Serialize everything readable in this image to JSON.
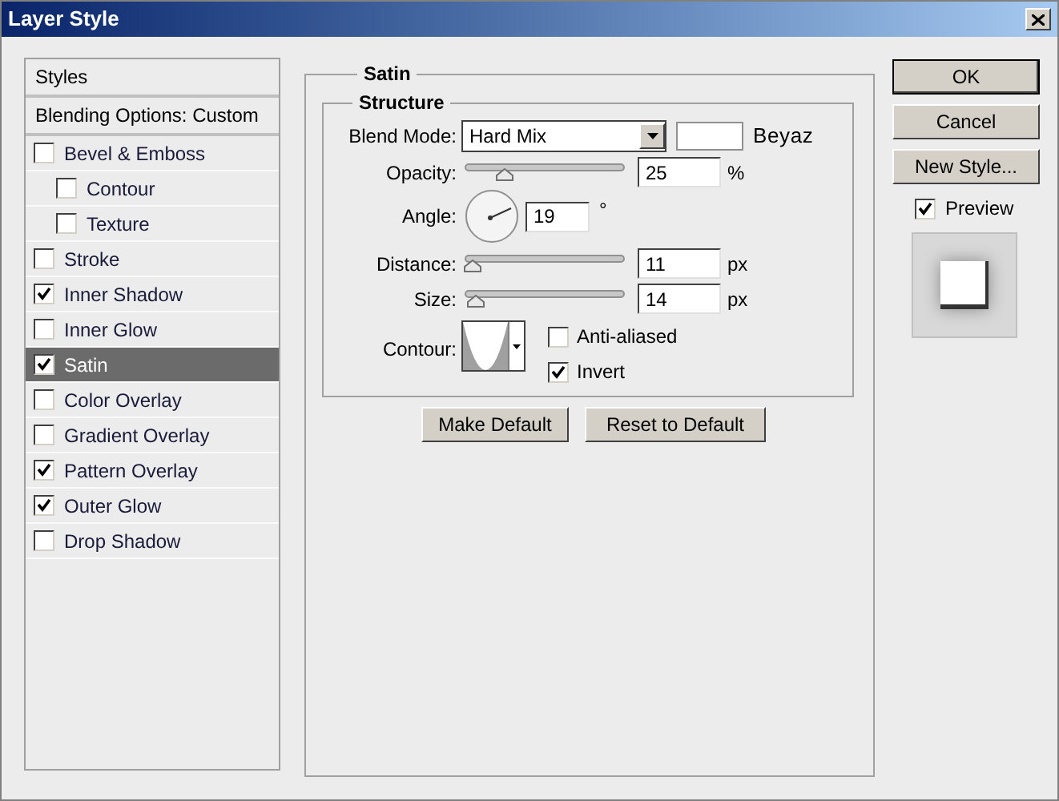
{
  "window": {
    "title": "Layer Style"
  },
  "sidebar": {
    "header": "Styles",
    "blending_options": "Blending Options: Custom",
    "items": [
      {
        "label": "Bevel & Emboss",
        "checked": false,
        "selected": false,
        "children": [
          {
            "label": "Contour",
            "checked": false,
            "selected": false
          },
          {
            "label": "Texture",
            "checked": false,
            "selected": false
          }
        ]
      },
      {
        "label": "Stroke",
        "checked": false,
        "selected": false
      },
      {
        "label": "Inner Shadow",
        "checked": true,
        "selected": false
      },
      {
        "label": "Inner Glow",
        "checked": false,
        "selected": false
      },
      {
        "label": "Satin",
        "checked": true,
        "selected": true
      },
      {
        "label": "Color Overlay",
        "checked": false,
        "selected": false
      },
      {
        "label": "Gradient Overlay",
        "checked": false,
        "selected": false
      },
      {
        "label": "Pattern Overlay",
        "checked": true,
        "selected": false
      },
      {
        "label": "Outer Glow",
        "checked": true,
        "selected": false
      },
      {
        "label": "Drop Shadow",
        "checked": false,
        "selected": false
      }
    ]
  },
  "panel": {
    "title": "Satin",
    "group": {
      "title": "Structure",
      "blend_mode": {
        "label": "Blend Mode:",
        "value": "Hard Mix",
        "color_name": "Beyaz"
      },
      "fields": [
        {
          "kind": "slider",
          "label": "Opacity:",
          "level": 0.25,
          "value": "25",
          "unit": "%"
        },
        {
          "kind": "dial",
          "label": "Angle:",
          "value": "19",
          "unit": "°"
        },
        {
          "kind": "slider",
          "label": "Distance:",
          "level": 0.05,
          "value": "11",
          "unit": "px"
        },
        {
          "kind": "slider",
          "label": "Size:",
          "level": 0.07,
          "value": "14",
          "unit": "px"
        }
      ],
      "contour": {
        "label": "Contour:"
      },
      "options": [
        {
          "label": "Anti-aliased",
          "checked": false
        },
        {
          "label": "Invert",
          "checked": true
        }
      ]
    },
    "buttons": [
      "Make Default",
      "Reset to Default"
    ]
  },
  "actions": [
    {
      "label": "OK",
      "default": true
    },
    {
      "label": "Cancel",
      "default": false
    },
    {
      "label": "New Style...",
      "default": false
    }
  ],
  "preview": {
    "label": "Preview",
    "checked": true
  }
}
